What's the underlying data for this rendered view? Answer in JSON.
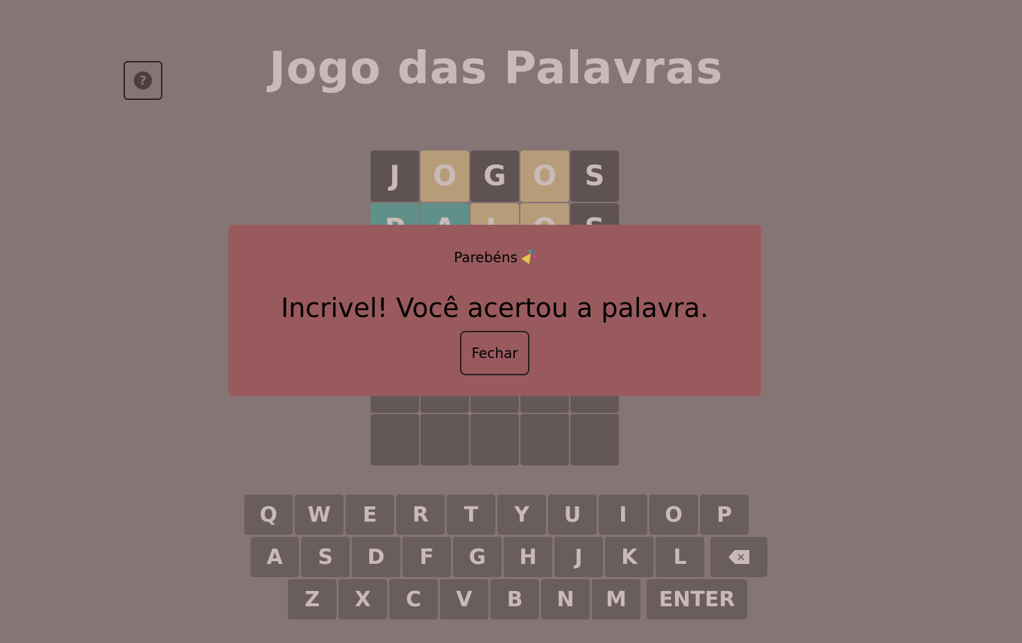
{
  "header": {
    "title": "Jogo das Palavras",
    "help_icon": "question-circle-icon",
    "help_symbol": "?"
  },
  "board": {
    "rows": [
      [
        {
          "letter": "J",
          "state": "absent"
        },
        {
          "letter": "O",
          "state": "present"
        },
        {
          "letter": "G",
          "state": "absent"
        },
        {
          "letter": "O",
          "state": "present"
        },
        {
          "letter": "S",
          "state": "absent"
        }
      ],
      [
        {
          "letter": "P",
          "state": "correct"
        },
        {
          "letter": "A",
          "state": "correct"
        },
        {
          "letter": "L",
          "state": "present"
        },
        {
          "letter": "O",
          "state": "present"
        },
        {
          "letter": "S",
          "state": "absent"
        }
      ],
      [
        {
          "letter": "",
          "state": "empty"
        },
        {
          "letter": "",
          "state": "empty"
        },
        {
          "letter": "",
          "state": "empty"
        },
        {
          "letter": "",
          "state": "empty"
        },
        {
          "letter": "",
          "state": "empty"
        }
      ],
      [
        {
          "letter": "",
          "state": "empty"
        },
        {
          "letter": "",
          "state": "empty"
        },
        {
          "letter": "",
          "state": "empty"
        },
        {
          "letter": "",
          "state": "empty"
        },
        {
          "letter": "",
          "state": "empty"
        }
      ],
      [
        {
          "letter": "",
          "state": "empty"
        },
        {
          "letter": "",
          "state": "empty"
        },
        {
          "letter": "",
          "state": "empty"
        },
        {
          "letter": "",
          "state": "empty"
        },
        {
          "letter": "",
          "state": "empty"
        }
      ],
      [
        {
          "letter": "",
          "state": "empty"
        },
        {
          "letter": "",
          "state": "empty"
        },
        {
          "letter": "",
          "state": "empty"
        },
        {
          "letter": "",
          "state": "empty"
        },
        {
          "letter": "",
          "state": "empty"
        }
      ]
    ]
  },
  "keyboard": {
    "row1": [
      "Q",
      "W",
      "E",
      "R",
      "T",
      "Y",
      "U",
      "I",
      "O",
      "P"
    ],
    "row2": [
      "A",
      "S",
      "D",
      "F",
      "G",
      "H",
      "J",
      "K",
      "L"
    ],
    "row3": [
      "Z",
      "X",
      "C",
      "V",
      "B",
      "N",
      "M"
    ],
    "enter_label": "ENTER",
    "backspace_icon": "backspace-icon",
    "backspace_symbol": "✕"
  },
  "modal": {
    "title": "Parebéns",
    "title_icon": "party-popper-icon",
    "message": "Incrivel! Você acertou a palavra.",
    "close_label": "Fechar"
  },
  "colors": {
    "background": "#857574",
    "tile_absent": "#5f5252",
    "tile_present": "#b79c7a",
    "tile_correct": "#61908a",
    "modal": "#995a5e"
  }
}
